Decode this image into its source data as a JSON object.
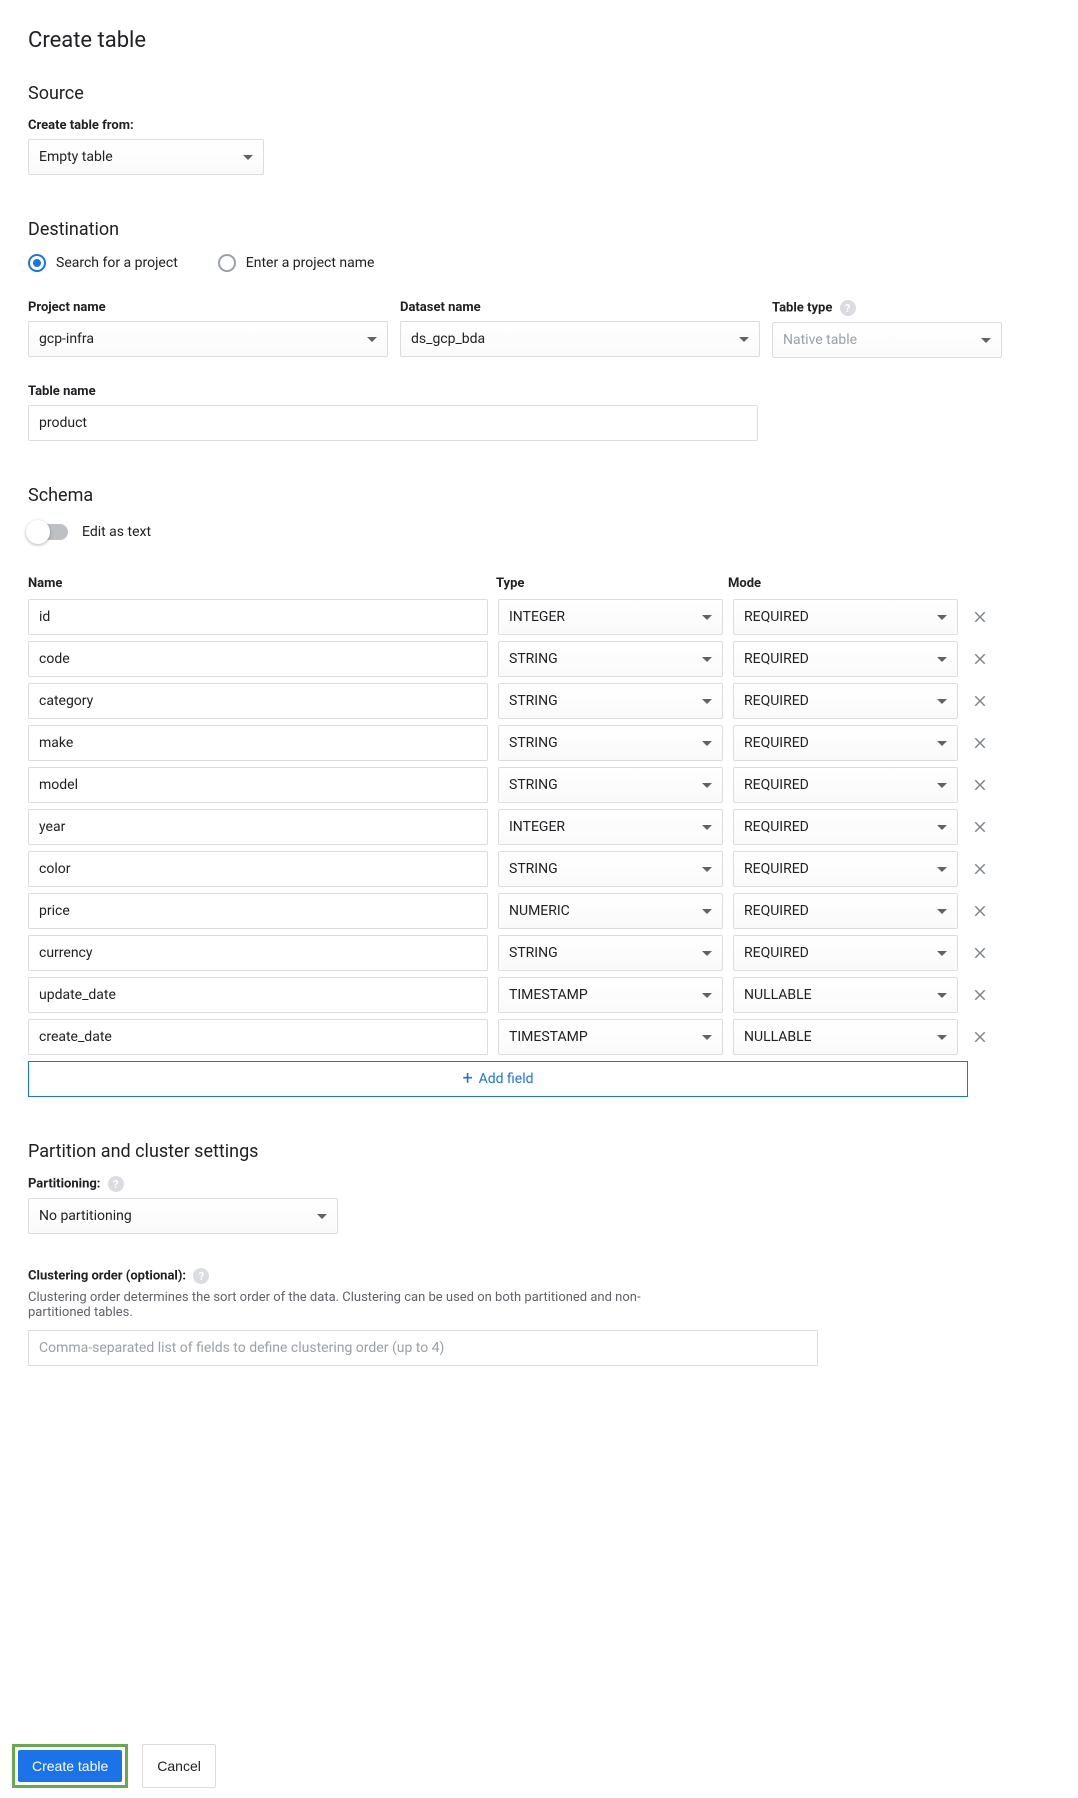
{
  "page": {
    "title": "Create table"
  },
  "source": {
    "heading": "Source",
    "label": "Create table from:",
    "value": "Empty table"
  },
  "destination": {
    "heading": "Destination",
    "radio_search": "Search for a project",
    "radio_enter": "Enter a project name",
    "project_label": "Project name",
    "project_value": "gcp-infra",
    "dataset_label": "Dataset name",
    "dataset_value": "ds_gcp_bda",
    "tabletype_label": "Table type",
    "tabletype_value": "Native table",
    "tablename_label": "Table name",
    "tablename_value": "product"
  },
  "schema": {
    "heading": "Schema",
    "edit_as_text": "Edit as text",
    "col_name": "Name",
    "col_type": "Type",
    "col_mode": "Mode",
    "fields": [
      {
        "name": "id",
        "type": "INTEGER",
        "mode": "REQUIRED"
      },
      {
        "name": "code",
        "type": "STRING",
        "mode": "REQUIRED"
      },
      {
        "name": "category",
        "type": "STRING",
        "mode": "REQUIRED"
      },
      {
        "name": "make",
        "type": "STRING",
        "mode": "REQUIRED"
      },
      {
        "name": "model",
        "type": "STRING",
        "mode": "REQUIRED"
      },
      {
        "name": "year",
        "type": "INTEGER",
        "mode": "REQUIRED"
      },
      {
        "name": "color",
        "type": "STRING",
        "mode": "REQUIRED"
      },
      {
        "name": "price",
        "type": "NUMERIC",
        "mode": "REQUIRED"
      },
      {
        "name": "currency",
        "type": "STRING",
        "mode": "REQUIRED"
      },
      {
        "name": "update_date",
        "type": "TIMESTAMP",
        "mode": "NULLABLE"
      },
      {
        "name": "create_date",
        "type": "TIMESTAMP",
        "mode": "NULLABLE"
      }
    ],
    "add_field": "Add field"
  },
  "partition": {
    "heading": "Partition and cluster settings",
    "partitioning_label": "Partitioning:",
    "partitioning_value": "No partitioning",
    "clustering_label": "Clustering order (optional):",
    "clustering_help": "Clustering order determines the sort order of the data. Clustering can be used on both partitioned and non-partitioned tables.",
    "clustering_placeholder": "Comma-separated list of fields to define clustering order (up to 4)"
  },
  "footer": {
    "create": "Create table",
    "cancel": "Cancel"
  }
}
